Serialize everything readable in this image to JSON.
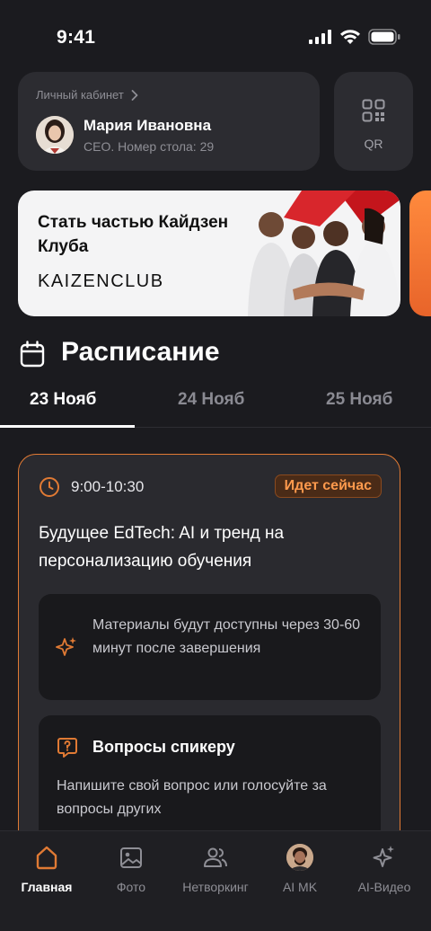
{
  "status_bar": {
    "time": "9:41"
  },
  "profile": {
    "link_label": "Личный кабинет",
    "name": "Мария Ивановна",
    "subtitle": "CEO. Номер стола: 29"
  },
  "qr": {
    "label": "QR"
  },
  "banner": {
    "title": "Стать частью Кайдзен Клуба",
    "logo_text": "KAIZENCLUB"
  },
  "schedule": {
    "title": "Расписание",
    "tabs": [
      {
        "label": "23 Нояб",
        "active": true
      },
      {
        "label": "24 Нояб",
        "active": false
      },
      {
        "label": "25 Нояб",
        "active": false
      }
    ]
  },
  "session": {
    "time": "9:00-10:30",
    "status_badge": "Идет сейчас",
    "title": "Будущее EdTech: AI и тренд на персонализацию обучения",
    "materials_note": "Материалы будут доступны через 30-60 минут после завершения",
    "questions_title": "Вопросы спикеру",
    "questions_text": "Напишите свой вопрос или голосуйте за вопросы других"
  },
  "bottom_nav": {
    "items": [
      {
        "label": "Главная",
        "icon": "home-icon",
        "active": true
      },
      {
        "label": "Фото",
        "icon": "photo-icon",
        "active": false
      },
      {
        "label": "Нетворкинг",
        "icon": "people-icon",
        "active": false
      },
      {
        "label": "AI MK",
        "icon": "avatar",
        "active": false
      },
      {
        "label": "AI-Видео",
        "icon": "sparkle-icon",
        "active": false
      }
    ]
  },
  "colors": {
    "background": "#1b1b1f",
    "card": "#2c2c31",
    "accent": "#e07a34",
    "badge_text": "#ff9a4d"
  }
}
